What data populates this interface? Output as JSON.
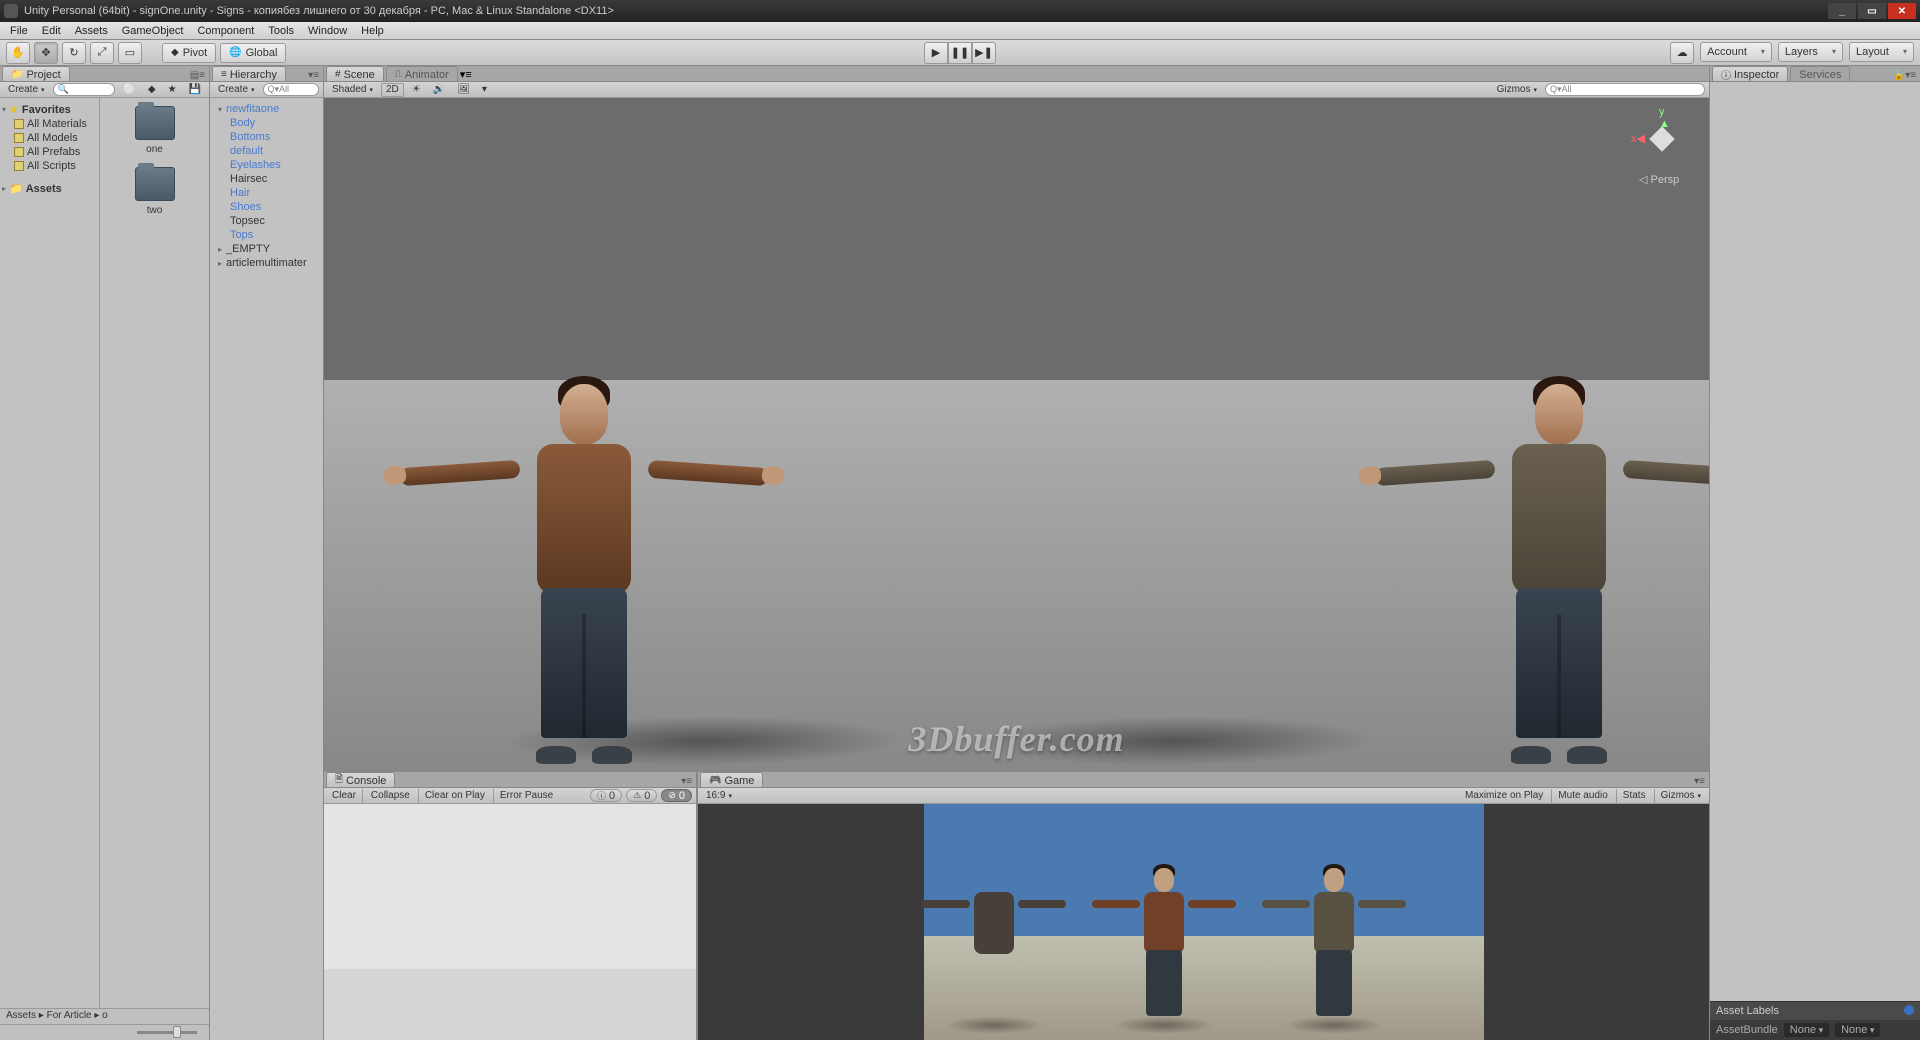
{
  "title": "Unity Personal (64bit) - signOne.unity - Signs - копиябез лишнего от 30 декабря - PC, Mac & Linux Standalone <DX11>",
  "menu": [
    "File",
    "Edit",
    "Assets",
    "GameObject",
    "Component",
    "Tools",
    "Window",
    "Help"
  ],
  "toolbar": {
    "pivot": "Pivot",
    "global": "Global",
    "account": "Account",
    "layers": "Layers",
    "layout": "Layout"
  },
  "project": {
    "tab": "Project",
    "create": "Create",
    "favorites": "Favorites",
    "favitems": [
      "All Materials",
      "All Models",
      "All Prefabs",
      "All Scripts"
    ],
    "assets": "Assets",
    "breadcrumb": "Assets  ▸  For Article  ▸  o",
    "folders": [
      "one",
      "two"
    ]
  },
  "hierarchy": {
    "tab": "Hierarchy",
    "create": "Create",
    "search": "Q▾All",
    "root": "newfitaone",
    "children": [
      "Body",
      "Bottoms",
      "default",
      "Eyelashes",
      "Hairsec",
      "Hair",
      "Shoes",
      "Topsec",
      "Tops"
    ],
    "items2": [
      "_EMPTY",
      "articlemultimater"
    ]
  },
  "scene": {
    "tab": "Scene",
    "animator": "Animator",
    "shaded": "Shaded",
    "mode2d": "2D",
    "gizmos": "Gizmos",
    "search": "Q▾All",
    "watermark": "3Dbuffer.com",
    "persp": "Persp"
  },
  "console": {
    "tab": "Console",
    "buttons": [
      "Clear",
      "Collapse",
      "Clear on Play",
      "Error Pause"
    ],
    "counts": {
      "info": "0",
      "warn": "0",
      "err": "0"
    }
  },
  "game": {
    "tab": "Game",
    "aspect": "16:9",
    "buttons": [
      "Maximize on Play",
      "Mute audio",
      "Stats",
      "Gizmos"
    ]
  },
  "inspector": {
    "tab": "Inspector",
    "services": "Services",
    "assetlabels": "Asset Labels",
    "assetbundle": "AssetBundle",
    "none1": "None",
    "none2": "None"
  }
}
